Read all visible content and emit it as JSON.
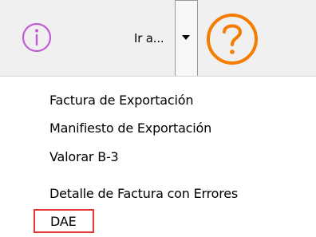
{
  "toolbar": {
    "goto_label": "Ir a...",
    "info_icon": "info-circle-icon",
    "help_icon": "question-circle-icon",
    "dropdown_icon": "caret-down-icon"
  },
  "menu": {
    "items": [
      {
        "label": "Factura de Exportación"
      },
      {
        "label": "Manifiesto de Exportación"
      },
      {
        "label": "Valorar B-3"
      },
      {
        "label": "Detalle de Factura con Errores"
      },
      {
        "label": "DAE",
        "highlighted": true
      }
    ]
  },
  "colors": {
    "info_icon": "#c25bd6",
    "help_icon": "#f57c00",
    "highlight_border": "#e53935",
    "toolbar_bg": "#f0f0f0"
  }
}
